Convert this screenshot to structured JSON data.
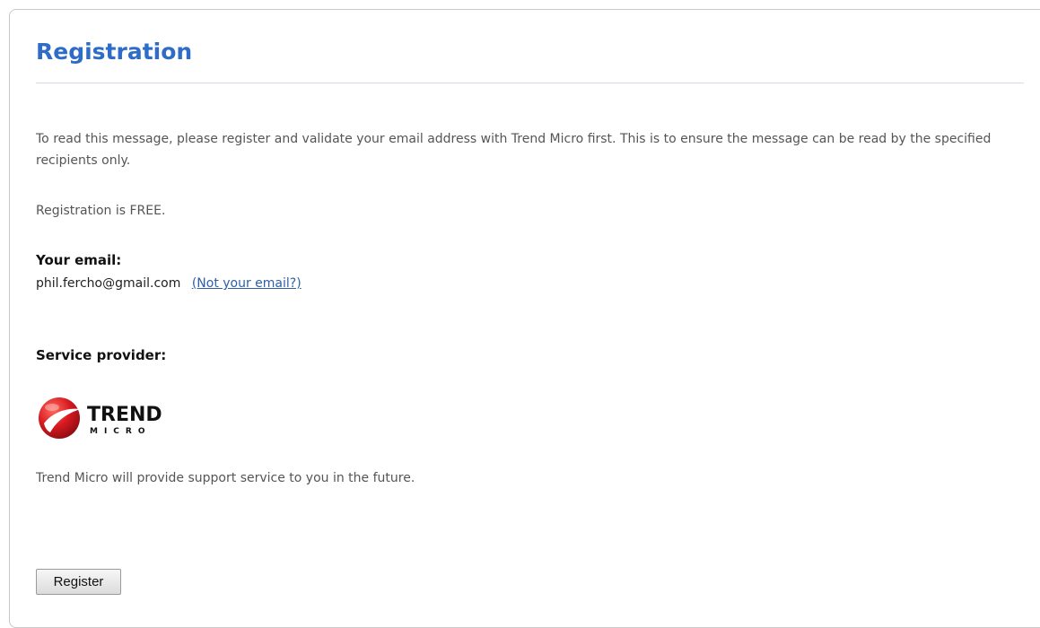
{
  "page": {
    "title": "Registration",
    "intro": "To read this message, please register and validate your email address with Trend Micro first. This is to ensure the message can be read by the specified recipients only.",
    "free_note": "Registration is FREE."
  },
  "email": {
    "label": "Your email:",
    "value": "phil.fercho@gmail.com",
    "not_your_email_link": "(Not your email?)"
  },
  "provider": {
    "label": "Service provider:",
    "logo_text_line1": "TREND",
    "logo_text_line2": "MICRO",
    "support_text": "Trend Micro will provide support service to you in the future."
  },
  "actions": {
    "register_label": "Register"
  },
  "colors": {
    "title": "#2e6cc8",
    "link": "#2f5fa8",
    "logo_red": "#d71920"
  }
}
